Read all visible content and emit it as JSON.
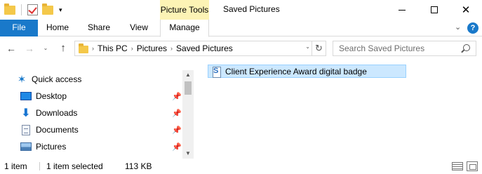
{
  "titlebar": {
    "contextual_tab_group": "Picture Tools",
    "window_title": "Saved Pictures",
    "qat_dropdown": "▾",
    "controls": {
      "minimize": "",
      "maximize": "",
      "close": "✕"
    }
  },
  "ribbon": {
    "tabs": [
      {
        "label": "File",
        "active": false
      },
      {
        "label": "Home",
        "active": false
      },
      {
        "label": "Share",
        "active": false
      },
      {
        "label": "View",
        "active": false
      },
      {
        "label": "Manage",
        "active": true
      }
    ],
    "expand_icon": "⌄",
    "help_icon": "?"
  },
  "navigation": {
    "back": "←",
    "forward": "→",
    "recent": "⌄",
    "up": "↑",
    "breadcrumb": [
      "This PC",
      "Pictures",
      "Saved Pictures"
    ],
    "crumb_separator": "›",
    "address_dropdown": "⌄",
    "refresh": "↻",
    "search_placeholder": "Search Saved Pictures"
  },
  "nav_pane": {
    "items": [
      {
        "label": "Quick access",
        "icon": "star-icon",
        "pinned": false
      },
      {
        "label": "Desktop",
        "icon": "desktop-icon",
        "pinned": true
      },
      {
        "label": "Downloads",
        "icon": "downloads-icon",
        "pinned": true
      },
      {
        "label": "Documents",
        "icon": "documents-icon",
        "pinned": true
      },
      {
        "label": "Pictures",
        "icon": "pictures-icon",
        "pinned": true
      }
    ],
    "pin_glyph": "📌",
    "star_glyph": "✶",
    "down_glyph": "⬇"
  },
  "scrollbar": {
    "up": "▲",
    "down": "▼"
  },
  "files": [
    {
      "name": "Client Experience Award digital badge",
      "selected": true,
      "icon": "sway-file-icon"
    }
  ],
  "status": {
    "item_count": "1 item",
    "selected": "1 item selected",
    "size": "113 KB"
  },
  "colors": {
    "accent": "#1979ca",
    "selection_bg": "#cce8ff",
    "selection_border": "#99d1ff",
    "contextual_tab": "#fcf3b5"
  }
}
